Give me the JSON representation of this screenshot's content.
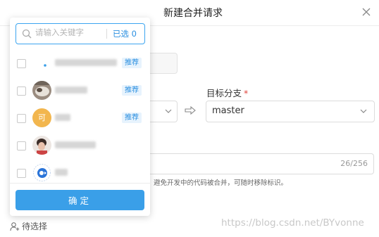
{
  "dialog": {
    "title": "新建合并请求",
    "close_icon": "close-icon"
  },
  "form": {
    "target_branch": {
      "label": "目标分支",
      "required_mark": "*",
      "value": "master"
    },
    "description": {
      "counter": "26/256"
    },
    "hint": "避免开发中的代码被合并，可随时移除标识。",
    "assignees": {
      "label": "待选择",
      "icon": "person-add-icon"
    }
  },
  "popover": {
    "search": {
      "placeholder": "请输入关键字",
      "selected_label": "已选 0"
    },
    "items": [
      {
        "avatar": "dot-avatar",
        "badge": "推荐"
      },
      {
        "avatar": "photo-avatar",
        "badge": "推荐"
      },
      {
        "avatar": "letter-avatar",
        "avatar_letter": "可",
        "badge": "推荐"
      },
      {
        "avatar": "photo-avatar",
        "badge": ""
      },
      {
        "avatar": "logo-avatar",
        "badge": ""
      }
    ],
    "confirm_label": "确定"
  },
  "watermark": "https://blog.csdn.net/BYvonne",
  "colors": {
    "accent": "#3a9fe8",
    "badge_bg": "#e7f3fd",
    "required": "#e0463e"
  }
}
